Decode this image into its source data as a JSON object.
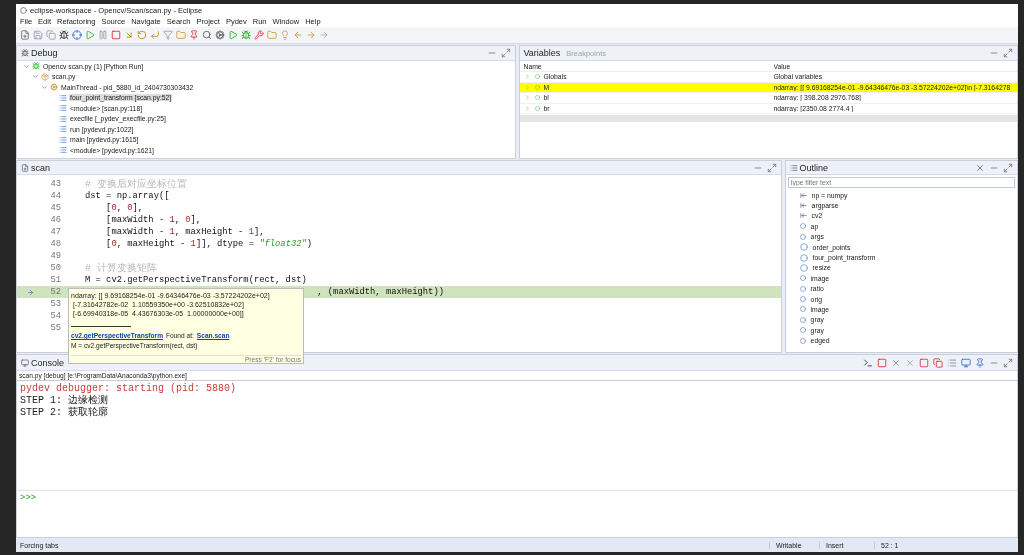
{
  "window": {
    "title": "eclipse-workspace - Opencv/Scan/scan.py - Eclipse"
  },
  "menu": [
    "File",
    "Edit",
    "Refactoring",
    "Source",
    "Navigate",
    "Search",
    "Project",
    "Pydev",
    "Run",
    "Window",
    "Help"
  ],
  "debug": {
    "tab": "Debug",
    "tree": [
      {
        "label": "Opencv scan.py (1) [Python Run]",
        "kind": "launch",
        "expanded": true,
        "children": [
          {
            "label": "scan.py",
            "kind": "process",
            "expanded": true,
            "children": [
              {
                "label": "MainThread - pid_5880_id_2404730303432",
                "kind": "thread",
                "expanded": true,
                "children": [
                  {
                    "label": "four_point_transform [scan.py:52]",
                    "kind": "frame",
                    "selected": true
                  },
                  {
                    "label": "<module> [scan.py:118]",
                    "kind": "frame",
                    "selected": false
                  },
                  {
                    "label": "execfile [_pydev_execfile.py:25]",
                    "kind": "frame",
                    "selected": false
                  },
                  {
                    "label": "run [pydevd.py:1022]",
                    "kind": "frame",
                    "selected": false
                  },
                  {
                    "label": "main [pydevd.py:1615]",
                    "kind": "frame",
                    "selected": false
                  },
                  {
                    "label": "<module> [pydevd.py:1621]",
                    "kind": "frame",
                    "selected": false
                  }
                ]
              }
            ]
          }
        ]
      }
    ]
  },
  "variables": {
    "tabs": [
      {
        "label": "Variables",
        "selected": true
      },
      {
        "label": "Breakpoints",
        "selected": false
      }
    ],
    "columns": [
      "Name",
      "Value"
    ],
    "rows": [
      {
        "name": "Globals",
        "value": "Global variables",
        "selected": false
      },
      {
        "name": "M",
        "value": "ndarray: [[ 9.69168254e-01 -9.64346476e-03 -3.57224202e+02]\\n [-7.3164278",
        "selected": true
      },
      {
        "name": "bl",
        "value": "ndarray: [ 398.208 2976.768]",
        "selected": false
      },
      {
        "name": "br",
        "value": "ndarray: [2350.08 2774.4 ]",
        "selected": false
      }
    ]
  },
  "editor": {
    "tab": "scan",
    "lines": [
      {
        "number": "43",
        "kind": "comment",
        "text": "# 变换后对应坐标位置"
      },
      {
        "number": "44",
        "kind": "code",
        "text": "dst = np.array(["
      },
      {
        "number": "45",
        "kind": "code",
        "text": "    [0, 0],"
      },
      {
        "number": "46",
        "kind": "code",
        "text": "    [maxWidth - 1, 0],"
      },
      {
        "number": "47",
        "kind": "code",
        "text": "    [maxWidth - 1, maxHeight - 1],"
      },
      {
        "number": "48",
        "kind": "code",
        "text": "    [0, maxHeight - 1]], dtype = \"float32\")"
      },
      {
        "number": "49",
        "kind": "code"
      },
      {
        "number": "50",
        "kind": "comment",
        "text": "# 计算变换矩阵"
      },
      {
        "number": "51",
        "kind": "code",
        "text": "M = cv2.getPerspectiveTransform(rect, dst)"
      },
      {
        "number": "52",
        "kind": "current",
        "text": ", (maxWidth, maxHeight))"
      },
      {
        "number": "53",
        "kind": "code"
      },
      {
        "number": "54",
        "kind": "code"
      },
      {
        "number": "55",
        "kind": "code"
      }
    ],
    "tooltip": {
      "lines": [
        "ndarray: [[ 9.69168254e-01 -9.64346476e-03 -3.57224202e+02]",
        " [-7.31642782e-02  1.10559350e+00 -3.62510832e+02]",
        " [-6.69940318e-05  4.43676303e-05  1.00000000e+00]]"
      ],
      "link": "cv2.getPerspectiveTransform",
      "found": "Found at:",
      "found_link": "Scan.scan",
      "source": "M = cv2.getPerspectiveTransform(rect, dst)",
      "hint": "Press 'F2' for focus"
    }
  },
  "outline": {
    "tab": "Outline",
    "placeholder": "type filter text",
    "items": [
      {
        "label": "np = numpy",
        "kind": "import"
      },
      {
        "label": "argparse",
        "kind": "import"
      },
      {
        "label": "cv2",
        "kind": "import"
      },
      {
        "label": "ap",
        "kind": "variable"
      },
      {
        "label": "args",
        "kind": "variable"
      },
      {
        "label": "order_points",
        "kind": "function"
      },
      {
        "label": "four_point_transform",
        "kind": "function"
      },
      {
        "label": "resize",
        "kind": "function"
      },
      {
        "label": "image",
        "kind": "variable"
      },
      {
        "label": "ratio",
        "kind": "variable"
      },
      {
        "label": "orig",
        "kind": "variable"
      },
      {
        "label": "image",
        "kind": "variable"
      },
      {
        "label": "gray",
        "kind": "variable"
      },
      {
        "label": "gray",
        "kind": "variable"
      },
      {
        "label": "edged",
        "kind": "variable"
      }
    ]
  },
  "console": {
    "tab": "Console",
    "process": "scan.py [debug] [e:\\ProgramData\\Anaconda3\\python.exe]",
    "lines": [
      {
        "kind": "error",
        "text": "pydev debugger: starting (pid: 5880)"
      },
      {
        "kind": "output",
        "text": "STEP 1: 边缘检测"
      },
      {
        "kind": "output",
        "text": "STEP 2: 获取轮廓"
      }
    ],
    "prompt": ">>>"
  },
  "status_bar": {
    "left": "Forcing tabs",
    "fields": [
      "Writable",
      "Insert",
      "52 : 1"
    ]
  }
}
